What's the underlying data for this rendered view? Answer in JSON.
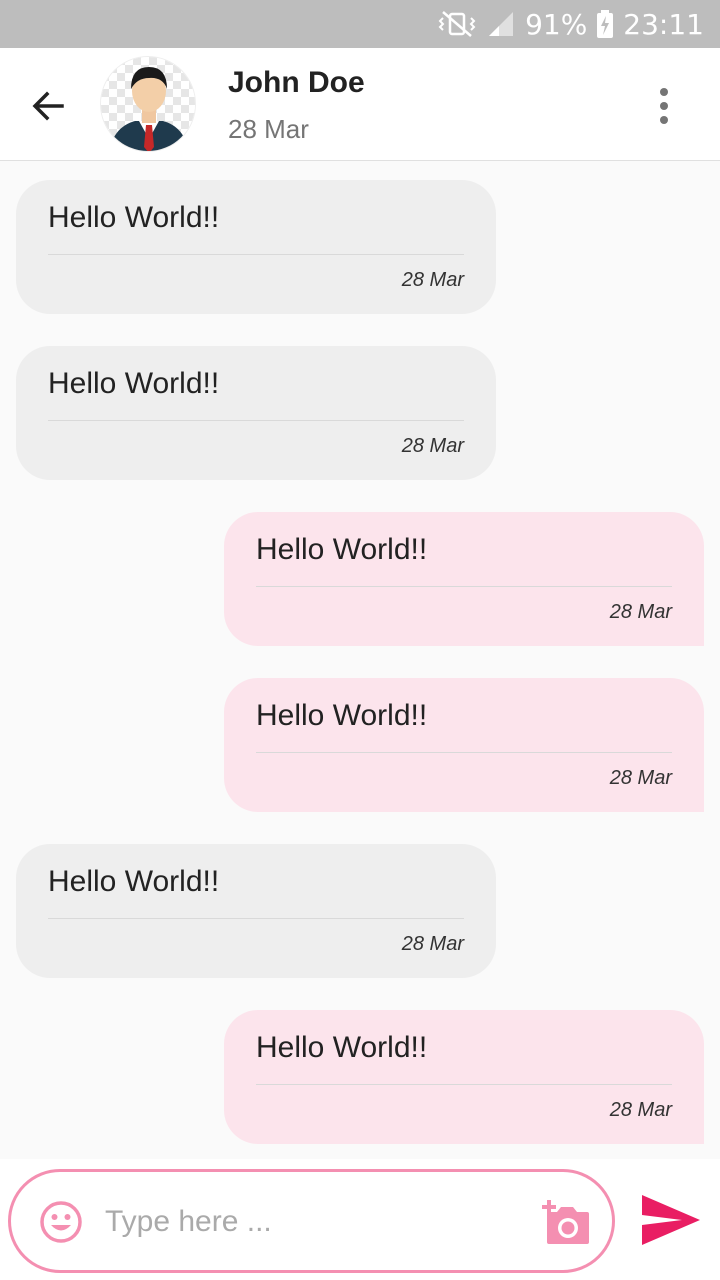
{
  "status_bar": {
    "battery": "91%",
    "time": "23:11"
  },
  "header": {
    "name": "John Doe",
    "date": "28 Mar"
  },
  "messages": [
    {
      "direction": "incoming",
      "text": "Hello World!!",
      "time": "28 Mar"
    },
    {
      "direction": "incoming",
      "text": "Hello World!!",
      "time": "28 Mar"
    },
    {
      "direction": "outgoing",
      "text": "Hello World!!",
      "time": "28 Mar"
    },
    {
      "direction": "outgoing",
      "text": "Hello World!!",
      "time": "28 Mar"
    },
    {
      "direction": "incoming",
      "text": "Hello World!!",
      "time": "28 Mar"
    },
    {
      "direction": "outgoing",
      "text": "Hello World!!",
      "time": "28 Mar"
    }
  ],
  "composer": {
    "placeholder": "Type here ..."
  },
  "icons": {
    "back": "arrow-left-icon",
    "menu": "more-vert-icon",
    "emoji": "smiley-icon",
    "camera": "add-photo-icon",
    "send": "send-icon"
  },
  "colors": {
    "accent": "#e91e63",
    "accent_light": "#f48fb1",
    "incoming_bubble": "#eeeeee",
    "outgoing_bubble": "#fce4ec",
    "status_bar": "#bdbdbd"
  }
}
